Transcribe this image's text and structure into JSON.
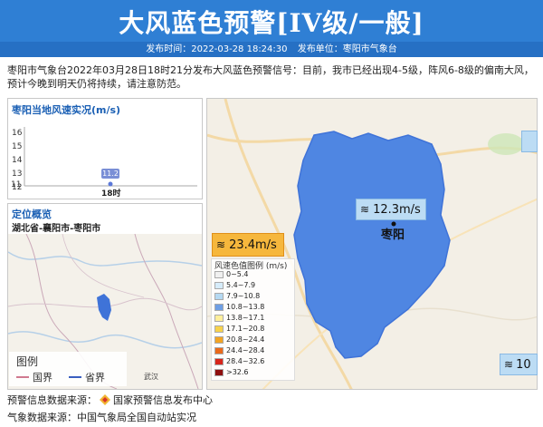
{
  "header": {
    "title": "大风蓝色预警[IV级/一般]",
    "publish_time": "发布时间：2022-03-28 18:24:30",
    "publish_unit": "发布单位：枣阳市气象台"
  },
  "description": "枣阳市气象台2022年03月28日18时21分发布大风蓝色预警信号：目前，我市已经出现4-5级，阵风6-8级的偏南大风，预计今晚到明天仍将持续，请注意防范。",
  "wind_chart": {
    "title": "枣阳当地风速实况(m/s)",
    "y_ticks": [
      "16",
      "15",
      "14",
      "13",
      "12",
      "11"
    ],
    "x_label": "18时",
    "value_label": "11.2"
  },
  "chart_data": {
    "type": "scatter",
    "title": "枣阳当地风速实况(m/s)",
    "categories": [
      "18时"
    ],
    "values": [
      11.2
    ],
    "ylim": [
      11,
      16
    ]
  },
  "location": {
    "title": "定位概览",
    "subtitle": "湖北省-襄阳市-枣阳市",
    "city_label": "武汉",
    "legend_title": "图例",
    "legend_items": [
      "国界",
      "省界"
    ]
  },
  "main_map": {
    "center_label": "枣阳",
    "wind_a": "12.3m/s",
    "wind_b": "23.4m/s",
    "wind_c": "10"
  },
  "wind_legend": {
    "title": "风速色值图例 (m/s)",
    "items": [
      {
        "label": "0~5.4",
        "color": "#f0f0f0"
      },
      {
        "label": "5.4~7.9",
        "color": "#d6ecfa"
      },
      {
        "label": "7.9~10.8",
        "color": "#b5d9f2"
      },
      {
        "label": "10.8~13.8",
        "color": "#6f9fe4"
      },
      {
        "label": "13.8~17.1",
        "color": "#ffef9c"
      },
      {
        "label": "17.1~20.8",
        "color": "#f7d24c"
      },
      {
        "label": "20.8~24.4",
        "color": "#f2a424"
      },
      {
        "label": "24.4~28.4",
        "color": "#ea6a1c"
      },
      {
        "label": "28.4~32.6",
        "color": "#d7261c"
      },
      {
        "label": ">32.6",
        "color": "#8e0f0f"
      }
    ]
  },
  "footer": {
    "source1_label": "预警信息数据来源：",
    "source1_value": "国家预警信息发布中心",
    "source2": "气象数据来源：中国气象局全国自动站实况"
  },
  "colors": {
    "banner": "#2f7fd4",
    "region_fill": "#4f86e2",
    "accent": "#1a5fb4"
  }
}
